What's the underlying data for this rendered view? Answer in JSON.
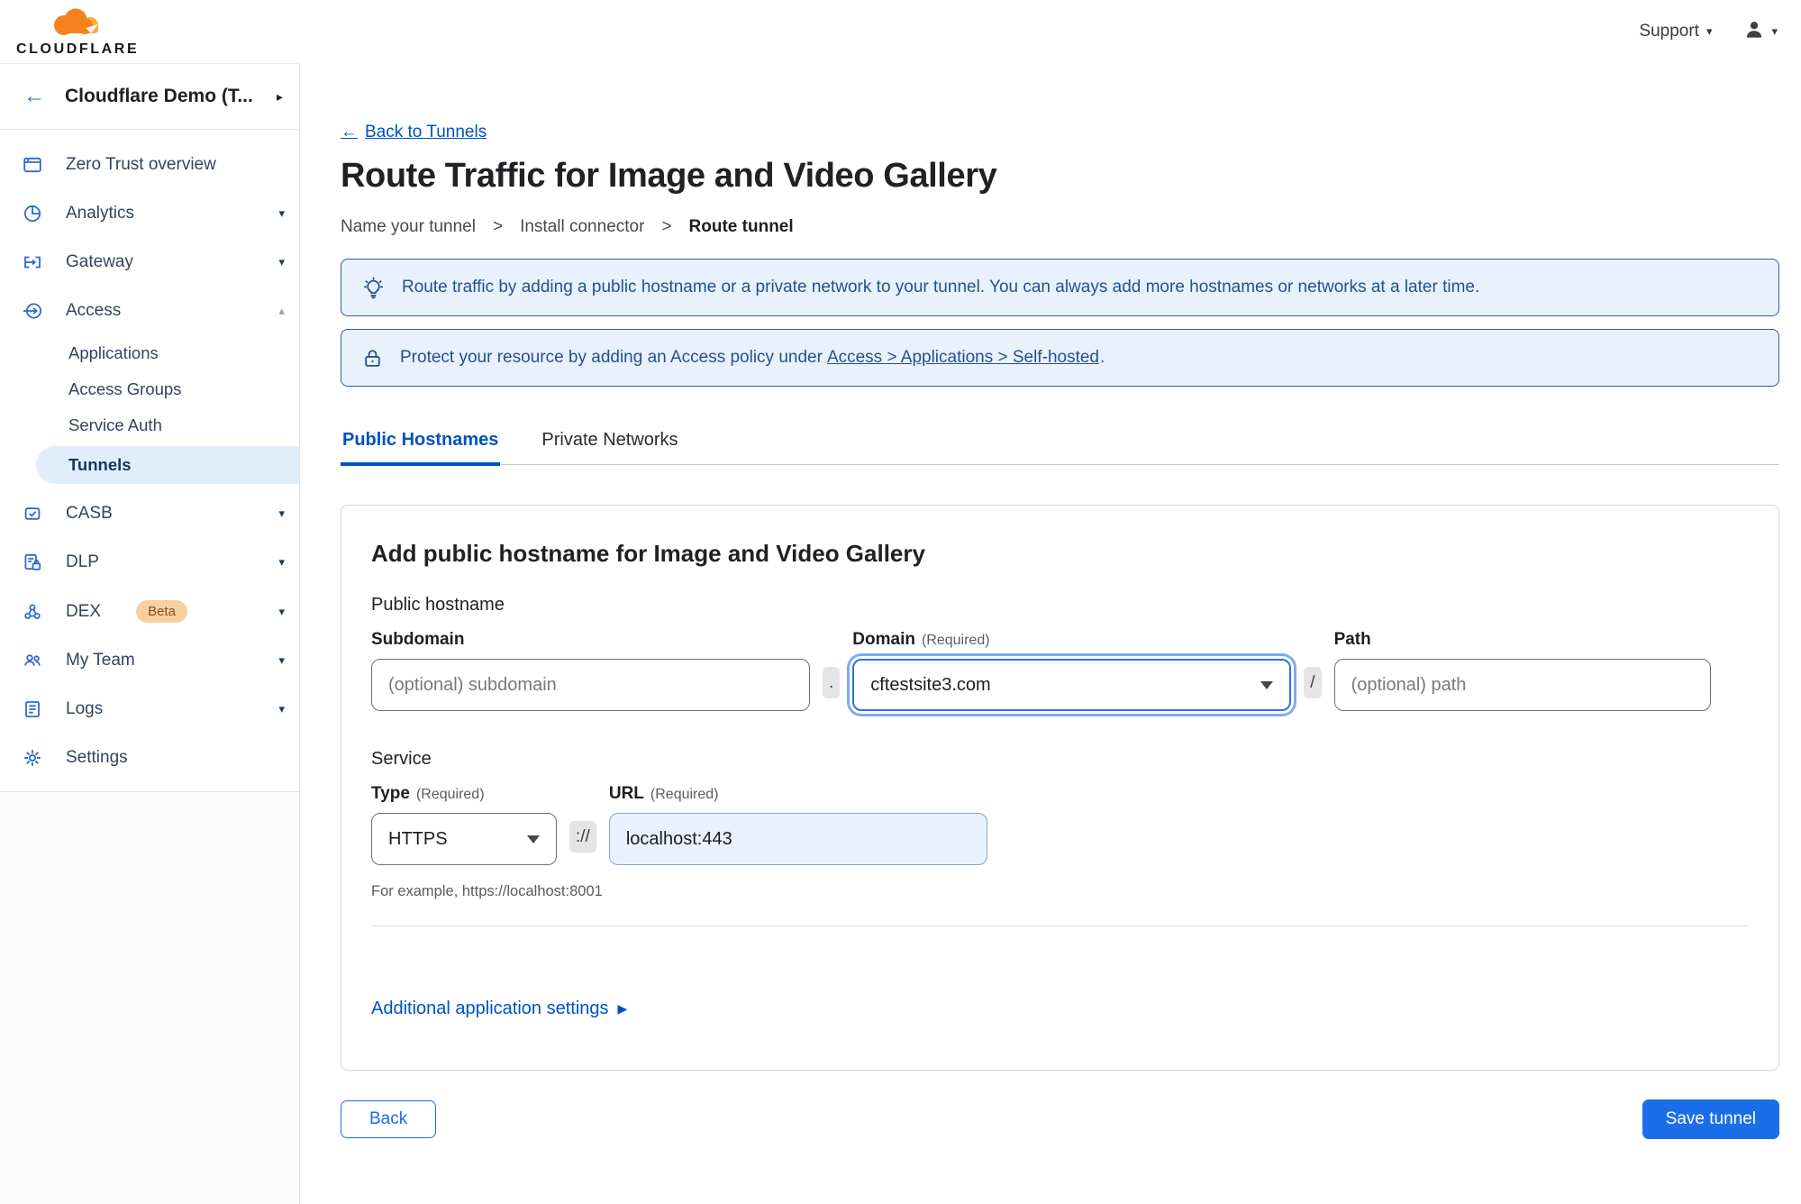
{
  "topbar": {
    "brand": "CLOUDFLARE",
    "support_label": "Support"
  },
  "icons": {
    "chevron_down": "▾",
    "chevron_up": "▴",
    "collapse": "▸",
    "back_arrow": "←",
    "disclosure": "▶"
  },
  "sidebar": {
    "account_label": "Cloudflare Demo (T...",
    "beta_badge": "Beta",
    "items": [
      {
        "label": "Zero Trust overview"
      },
      {
        "label": "Analytics"
      },
      {
        "label": "Gateway"
      },
      {
        "label": "Access"
      },
      {
        "label": "Applications"
      },
      {
        "label": "Access Groups"
      },
      {
        "label": "Service Auth"
      },
      {
        "label": "Tunnels"
      },
      {
        "label": "CASB"
      },
      {
        "label": "DLP"
      },
      {
        "label": "DEX"
      },
      {
        "label": "My Team"
      },
      {
        "label": "Logs"
      },
      {
        "label": "Settings"
      }
    ]
  },
  "main": {
    "back_link": "Back to Tunnels",
    "title": "Route Traffic for Image and Video Gallery",
    "steps": [
      "Name your tunnel",
      "Install connector",
      "Route tunnel"
    ],
    "step_separator": ">",
    "banners": {
      "tip": "Route traffic by adding a public hostname or a private network to your tunnel. You can always add more hostnames or networks at a later time.",
      "protect_prefix": "Protect your resource by adding an Access policy under",
      "protect_link": "Access > Applications > Self-hosted",
      "protect_suffix": "."
    },
    "tabs": [
      {
        "label": "Public Hostnames"
      },
      {
        "label": "Private Networks"
      }
    ],
    "form": {
      "heading": "Add public hostname for Image and Video Gallery",
      "public_hostname_label": "Public hostname",
      "subdomain_label": "Subdomain",
      "subdomain_placeholder": "(optional) subdomain",
      "domain_label": "Domain",
      "required_label": "(Required)",
      "domain_value": "cftestsite3.com",
      "path_label": "Path",
      "path_placeholder": "(optional) path",
      "sep_dot": ".",
      "sep_slash": "/",
      "sep_scheme": "://",
      "service_label": "Service",
      "type_label": "Type",
      "type_value": "HTTPS",
      "url_label": "URL",
      "url_value": "localhost:443",
      "example": "For example, https://localhost:8001",
      "additional_label": "Additional application settings"
    },
    "footer": {
      "back_label": "Back",
      "save_label": "Save tunnel"
    }
  }
}
